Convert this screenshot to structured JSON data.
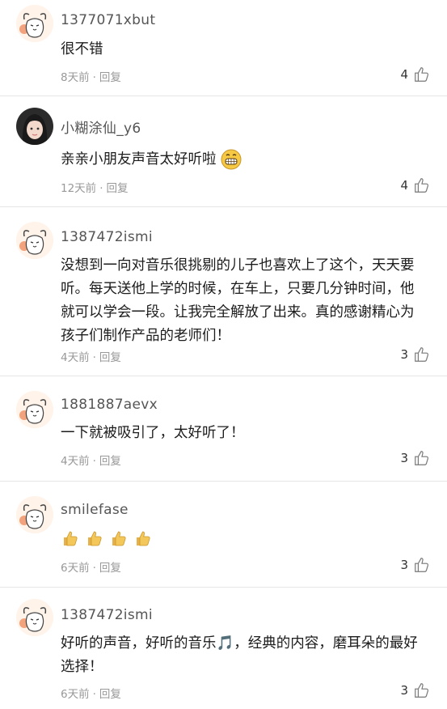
{
  "comments": [
    {
      "username": "1377071xbut",
      "text": "很不错",
      "time": "8天前",
      "reply": "回复",
      "likes": "4",
      "avatar": "cat"
    },
    {
      "username": "小糊涂仙_y6",
      "text": "亲亲小朋友声音太好听啦",
      "time": "12天前",
      "reply": "回复",
      "likes": "4",
      "avatar": "girl",
      "emoji": "grin-emoji"
    },
    {
      "username": "1387472ismi",
      "text": "没想到一向对音乐很挑剔的儿子也喜欢上了这个，天天要听。每天送他上学的时候，在车上，只要几分钟时间，他就可以学会一段。让我完全解放了出来。真的感谢精心为孩子们制作产品的老师们！",
      "time": "4天前",
      "reply": "回复",
      "likes": "3",
      "avatar": "cat"
    },
    {
      "username": "1881887aevx",
      "text": "一下就被吸引了，太好听了！",
      "time": "4天前",
      "reply": "回复",
      "likes": "3",
      "avatar": "cat"
    },
    {
      "username": "smilefase",
      "text": "",
      "time": "6天前",
      "reply": "回复",
      "likes": "3",
      "avatar": "cat",
      "emoji": "thumbs-up-emoji"
    },
    {
      "username": "1387472ismi",
      "text": "好听的声音，好听的音乐🎵，经典的内容，磨耳朵的最好选择！",
      "time": "6天前",
      "reply": "回复",
      "likes": "3",
      "avatar": "cat"
    }
  ],
  "separator": "·",
  "colors": {
    "meta": "#999999",
    "divider": "#e6e6e6",
    "text": "#1c1c1c"
  }
}
